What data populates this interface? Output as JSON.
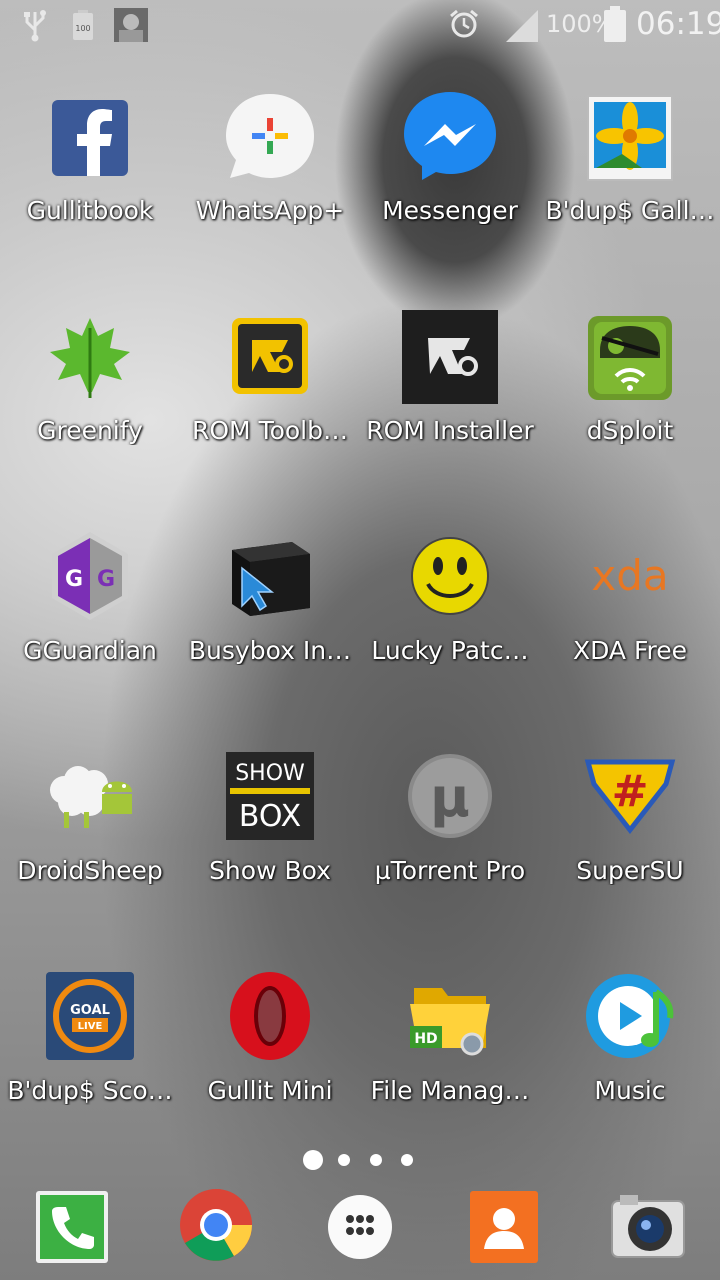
{
  "status_bar": {
    "battery_percent": "100%",
    "time": "06:19",
    "battery_box_text": "100"
  },
  "apps": [
    {
      "label": "Gullitbook",
      "icon": "facebook-icon"
    },
    {
      "label": "WhatsApp+",
      "icon": "whatsapp-plus-icon"
    },
    {
      "label": "Messenger",
      "icon": "messenger-icon"
    },
    {
      "label": "B'dup$ Gall…",
      "icon": "gallery-icon"
    },
    {
      "label": "Greenify",
      "icon": "greenify-leaf-icon"
    },
    {
      "label": "ROM Toolb…",
      "icon": "rom-toolbox-icon"
    },
    {
      "label": "ROM Installer",
      "icon": "rom-installer-icon"
    },
    {
      "label": "dSploit",
      "icon": "dsploit-icon"
    },
    {
      "label": "GGuardian",
      "icon": "gameguardian-icon"
    },
    {
      "label": "Busybox In…",
      "icon": "busybox-cube-icon"
    },
    {
      "label": "Lucky Patc…",
      "icon": "smiley-icon"
    },
    {
      "label": "XDA Free",
      "icon": "xda-icon",
      "text": "xda"
    },
    {
      "label": "DroidSheep",
      "icon": "droidsheep-icon"
    },
    {
      "label": "Show Box",
      "icon": "showbox-icon",
      "text_top": "SHOW",
      "text_bottom": "BOX"
    },
    {
      "label": "µTorrent Pro",
      "icon": "utorrent-icon",
      "text": "µ"
    },
    {
      "label": "SuperSU",
      "icon": "supersu-icon",
      "text": "#"
    },
    {
      "label": "B'dup$ Sco…",
      "icon": "goal-live-icon",
      "text_top": "GOAL",
      "text_bottom": "LIVE"
    },
    {
      "label": "Gullit Mini",
      "icon": "opera-mini-icon"
    },
    {
      "label": "File Manag…",
      "icon": "file-manager-icon",
      "text": "HD"
    },
    {
      "label": "Music",
      "icon": "music-play-icon"
    }
  ],
  "page_indicator": {
    "pages": 4,
    "current": 1
  },
  "dock": [
    {
      "icon": "phone-icon"
    },
    {
      "icon": "chrome-icon"
    },
    {
      "icon": "app-drawer-icon"
    },
    {
      "icon": "contacts-icon"
    },
    {
      "icon": "camera-icon"
    }
  ]
}
